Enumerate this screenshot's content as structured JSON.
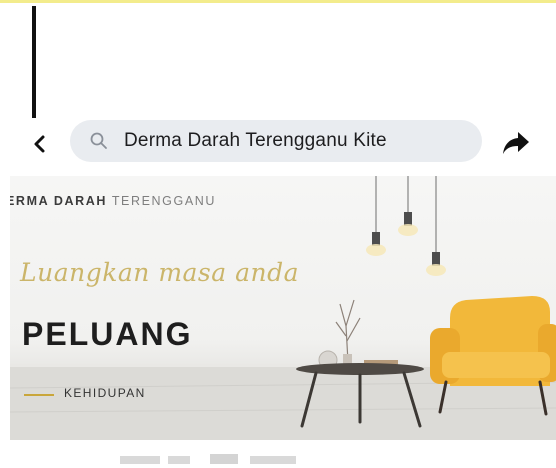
{
  "nav": {
    "search_query": "Derma Darah Terengganu Kite"
  },
  "banner": {
    "brand_bold": "ERMA DARAH",
    "brand_light": "TERENGGANU",
    "script_text": "Luangkan masa anda",
    "headline": "PELUANG",
    "tagline": "KEHIDUPAN"
  },
  "icons": {
    "back": "chevron-left-icon",
    "search": "magnifier-icon",
    "share": "share-arrow-icon"
  },
  "colors": {
    "accent_gold": "#cbb56a",
    "chair": "#f2b83a",
    "search_bg": "#e9ecf0",
    "top_strip": "#f3ec8c"
  }
}
